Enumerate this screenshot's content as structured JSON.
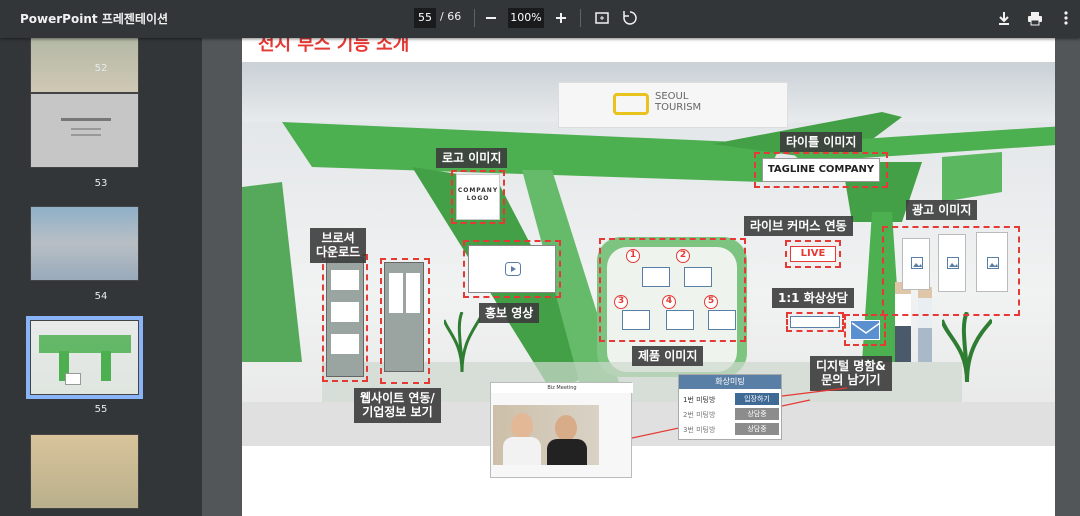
{
  "toolbar": {
    "title": "PowerPoint 프레젠테이션",
    "page_current": "55",
    "page_sep_total": "/  66",
    "zoom": "100%",
    "icons": [
      "minus-icon",
      "plus-icon",
      "fit-page-icon",
      "rotate-icon",
      "download-icon",
      "print-icon",
      "more-vert-icon"
    ]
  },
  "sidebar": {
    "thumbs": [
      {
        "num": "52"
      },
      {
        "num": "53"
      },
      {
        "num": "54"
      },
      {
        "num": "55",
        "selected": true
      },
      {
        "num": ""
      }
    ]
  },
  "slide": {
    "title": "전시 부스 기능 소개",
    "scene_sign": "SEOUL\nTOURISM",
    "labels": {
      "logo_image": "로고 이미지",
      "company_logo": "COMPANY\nLOGO",
      "title_image": "타이틀 이미지",
      "tagline": "TAGLINE COMPANY",
      "live_commerce": "라이브 커머스 연동",
      "live": "LIVE",
      "ad_image": "광고 이미지",
      "brochure": "브로셔\n다운로드",
      "promo_video": "홍보 영상",
      "product_image": "제품 이미지",
      "video_consult": "1:1 화상상담",
      "digital_card": "디지털 명함&\n문의 남기기",
      "website_link": "웹사이트 연동/\n기업정보 보기"
    },
    "product_numbers": [
      "1",
      "2",
      "3",
      "4",
      "5"
    ],
    "meeting": {
      "title": "화상미팅",
      "rows": [
        {
          "room": "1번 미팅방",
          "action": "입장하기"
        },
        {
          "room": "2번 미팅방",
          "action": "상담중"
        },
        {
          "room": "3번 미팅방",
          "action": "상담중"
        }
      ]
    },
    "video_window_title": "Biz Meeting",
    "accent_color": "#e53935",
    "booth_green": "#4caf50"
  }
}
